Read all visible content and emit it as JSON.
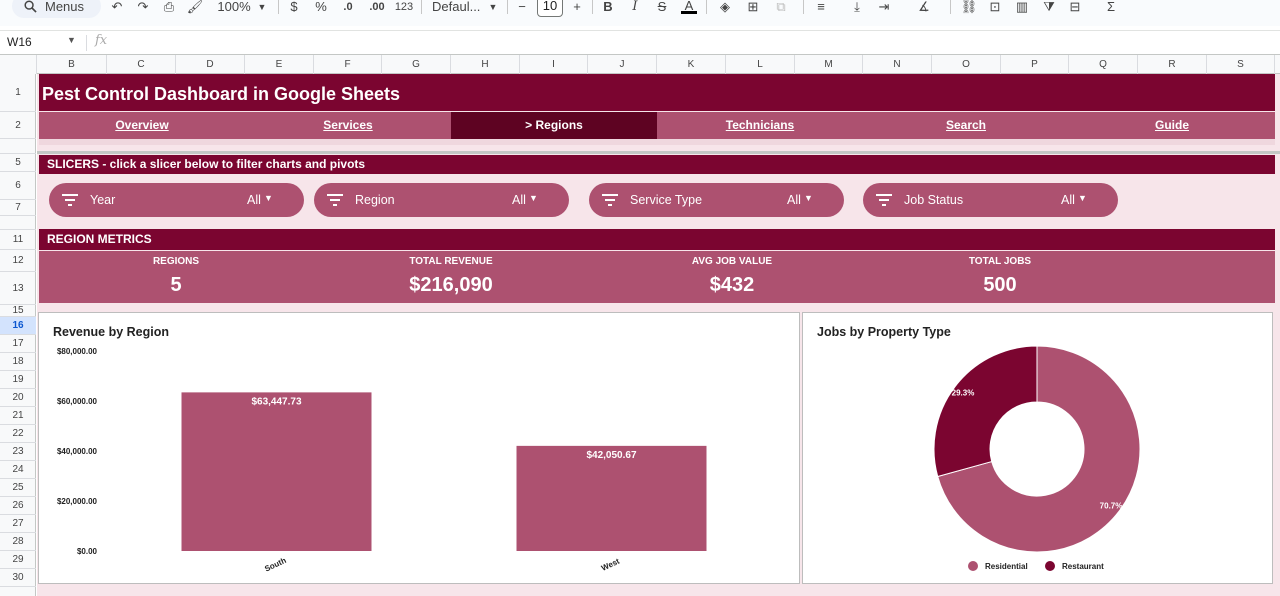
{
  "toolbar": {
    "search_label": "Menus",
    "zoom": "100%",
    "currency": "$",
    "percent": "%",
    "dec_decrease": ".0",
    "dec_increase": ".00",
    "number_format": "123",
    "font_name": "Defaul...",
    "font_size": "10",
    "bold": "B",
    "italic": "I",
    "strike": "S",
    "text_color": "A",
    "sum": "Σ"
  },
  "formula_bar": {
    "cell_ref": "W16",
    "fx": "fx"
  },
  "columns": [
    "B",
    "C",
    "D",
    "E",
    "F",
    "G",
    "H",
    "I",
    "J",
    "K",
    "L",
    "M",
    "N",
    "O",
    "P",
    "Q",
    "R",
    "S"
  ],
  "rows": [
    "1",
    "2",
    "",
    "5",
    "6",
    "7",
    "",
    "11",
    "12",
    "13",
    "15",
    "16",
    "17",
    "18",
    "19",
    "20",
    "21",
    "22",
    "23",
    "24",
    "25",
    "26",
    "27",
    "28",
    "29",
    "30"
  ],
  "sheet": {
    "title": "Pest Control Dashboard in Google Sheets",
    "nav": [
      {
        "label": "Overview",
        "active": false
      },
      {
        "label": "Services",
        "active": false
      },
      {
        "label": "> Regions",
        "active": true
      },
      {
        "label": "Technicians",
        "active": false
      },
      {
        "label": "Search",
        "active": false
      },
      {
        "label": "Guide",
        "active": false
      }
    ],
    "slicers_header": "SLICERS  -  click a slicer below to filter charts and pivots",
    "slicers": [
      {
        "label": "Year",
        "value": "All"
      },
      {
        "label": "Region",
        "value": "All"
      },
      {
        "label": "Service Type",
        "value": "All"
      },
      {
        "label": "Job Status",
        "value": "All"
      }
    ],
    "metrics_header": "REGION METRICS",
    "metrics": [
      {
        "label": "REGIONS",
        "value": "5"
      },
      {
        "label": "TOTAL REVENUE",
        "value": "$216,090"
      },
      {
        "label": "AVG JOB VALUE",
        "value": "$432"
      },
      {
        "label": "TOTAL JOBS",
        "value": "500"
      }
    ]
  },
  "colors": {
    "dark": "#7b0530",
    "mid": "#ad5170",
    "light": "#f7e5ea",
    "active_tab": "#5e0322"
  },
  "chart_data": [
    {
      "type": "bar",
      "title": "Revenue by Region",
      "categories": [
        "South",
        "West"
      ],
      "values": [
        63447.73,
        42050.67
      ],
      "data_labels": [
        "$63,447.73",
        "$42,050.67"
      ],
      "y_ticks": [
        "$0.00",
        "$20,000.00",
        "$40,000.00",
        "$60,000.00",
        "$80,000.00"
      ],
      "ylim": [
        0,
        80000
      ],
      "color": "#ad5170"
    },
    {
      "type": "pie",
      "title": "Jobs by Property Type",
      "labels": [
        "Residential",
        "Restaurant"
      ],
      "values": [
        70.7,
        29.3
      ],
      "data_labels": [
        "70.7%",
        "29.3%"
      ],
      "colors": [
        "#ad5170",
        "#7b0530"
      ],
      "legend": "bottom"
    }
  ]
}
